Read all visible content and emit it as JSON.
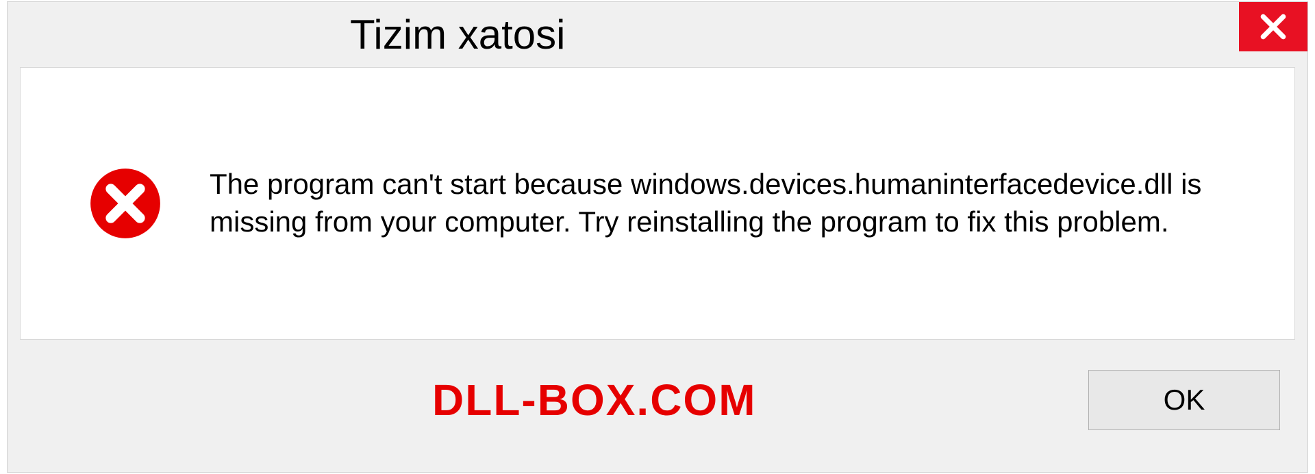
{
  "dialog": {
    "title": "Tizim xatosi",
    "message": "The program can't start because windows.devices.humaninterfacedevice.dll is missing from your computer. Try reinstalling the program to fix this problem.",
    "ok_label": "OK"
  },
  "brand": "DLL-BOX.COM",
  "colors": {
    "close_bg": "#e81123",
    "error_red": "#e60000",
    "brand_red": "#e60000"
  }
}
